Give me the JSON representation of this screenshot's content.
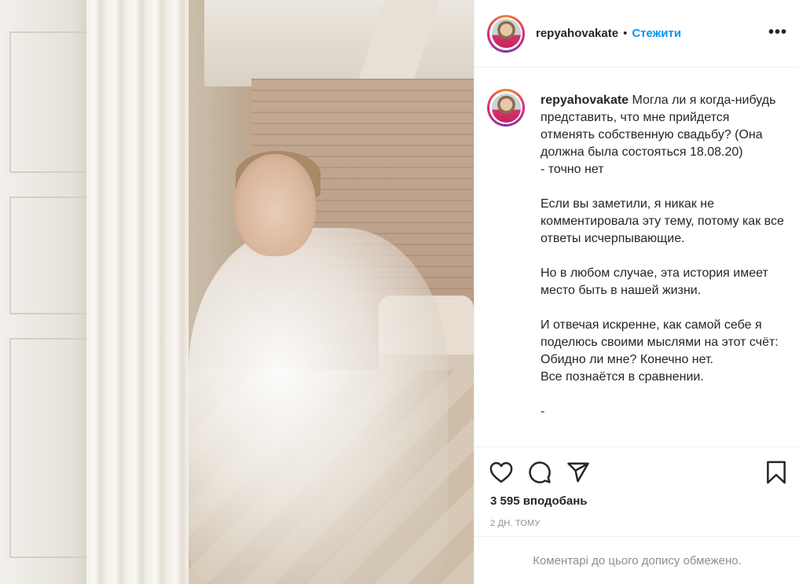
{
  "post": {
    "username": "repyahovakate",
    "separator": "•",
    "follow_label": "Стежити",
    "more_label": "•••",
    "caption": "Могла ли я когда-нибудь представить, что мне прийдется отменять собственную свадьбу? (Она должна была состояться 18.08.20)\n- точно нет\n\nЕсли вы заметили, я никак не комментировала эту тему, потому как все ответы исчерпывающие.\n\nНо в любом случае, эта история имеет место быть в нашей жизни.\n\nИ отвечая искренне, как самой себе я поделюсь своими мыслями на этот счёт:\nОбидно ли мне? Конечно нет.\nВсе познаётся в сравнении.\n\n- ",
    "likes": "3 595 вподобань",
    "time": "2 ДН. ТОМУ",
    "comments_notice": "Коментарі до цього допису обмежено."
  },
  "icons": {
    "like": "heart-icon",
    "comment": "comment-icon",
    "share": "send-icon",
    "save": "bookmark-icon"
  },
  "colors": {
    "link_blue": "#0095f6",
    "text": "#262626",
    "muted": "#8e8e8e",
    "divider": "#efefef"
  }
}
